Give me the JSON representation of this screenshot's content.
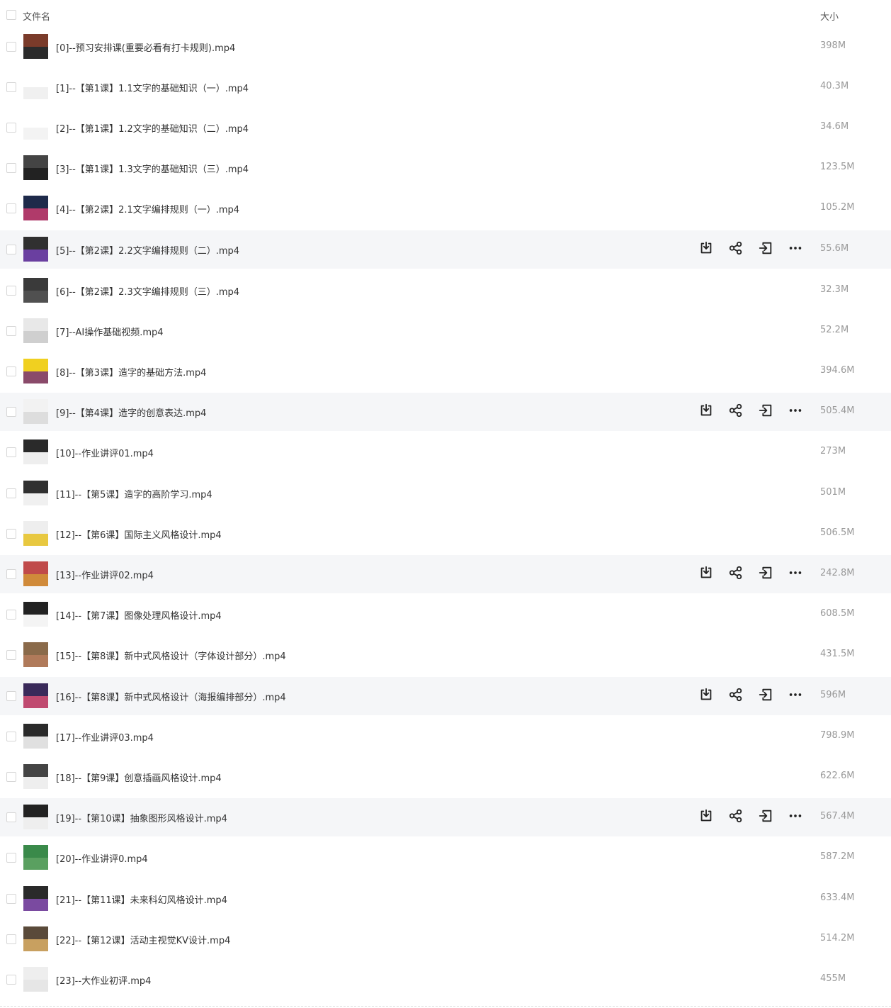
{
  "header": {
    "name_label": "文件名",
    "size_label": "大小"
  },
  "row_actions": [
    "download-icon",
    "share-icon",
    "move-icon",
    "more-icon"
  ],
  "colors": {
    "highlight": "#f5f6f8",
    "muted_text": "#999999",
    "text": "#333333"
  },
  "files": [
    {
      "name": "[0]--预习安排课(重要必看有打卡规则).mp4",
      "size": "398M",
      "thumb": [
        "#7a3b2a",
        "#2b2b2b"
      ]
    },
    {
      "name": "[1]--【第1课】1.1文字的基础知识（一）.mp4",
      "size": "40.3M",
      "thumb": [
        "#ffffff",
        "#f0f0f0"
      ]
    },
    {
      "name": "[2]--【第1课】1.2文字的基础知识（二）.mp4",
      "size": "34.6M",
      "thumb": [
        "#ffffff",
        "#f3f3f3"
      ]
    },
    {
      "name": "[3]--【第1课】1.3文字的基础知识（三）.mp4",
      "size": "123.5M",
      "thumb": [
        "#444444",
        "#222222"
      ]
    },
    {
      "name": "[4]--【第2课】2.1文字编排规则（一）.mp4",
      "size": "105.2M",
      "thumb": [
        "#1e2a4a",
        "#b03a6a"
      ]
    },
    {
      "name": "[5]--【第2课】2.2文字编排规则（二）.mp4",
      "size": "55.6M",
      "thumb": [
        "#303030",
        "#6a3fa0"
      ]
    },
    {
      "name": "[6]--【第2课】2.3文字编排规则（三）.mp4",
      "size": "32.3M",
      "thumb": [
        "#3a3a3a",
        "#505050"
      ]
    },
    {
      "name": "[7]--AI操作基础视频.mp4",
      "size": "52.2M",
      "thumb": [
        "#e8e8e8",
        "#cfcfcf"
      ]
    },
    {
      "name": "[8]--【第3课】造字的基础方法.mp4",
      "size": "394.6M",
      "thumb": [
        "#f0d020",
        "#8a4a6a"
      ]
    },
    {
      "name": "[9]--【第4课】造字的创意表达.mp4",
      "size": "505.4M",
      "thumb": [
        "#f2f2f2",
        "#dddddd"
      ]
    },
    {
      "name": "[10]--作业讲评01.mp4",
      "size": "273M",
      "thumb": [
        "#2a2a2a",
        "#eeeeee"
      ]
    },
    {
      "name": "[11]--【第5课】造字的高阶学习.mp4",
      "size": "501M",
      "thumb": [
        "#303030",
        "#f0f0f0"
      ]
    },
    {
      "name": "[12]--【第6课】国际主义风格设计.mp4",
      "size": "506.5M",
      "thumb": [
        "#eeeeee",
        "#e8c840"
      ]
    },
    {
      "name": "[13]--作业讲评02.mp4",
      "size": "242.8M",
      "thumb": [
        "#c04a4a",
        "#d08a3a"
      ]
    },
    {
      "name": "[14]--【第7课】图像处理风格设计.mp4",
      "size": "608.5M",
      "thumb": [
        "#222222",
        "#f4f4f4"
      ]
    },
    {
      "name": "[15]--【第8课】新中式风格设计（字体设计部分）.mp4",
      "size": "431.5M",
      "thumb": [
        "#8a6a4a",
        "#b07a5a"
      ]
    },
    {
      "name": "[16]--【第8课】新中式风格设计（海报编排部分）.mp4",
      "size": "596M",
      "thumb": [
        "#3a2a5a",
        "#c04a70"
      ]
    },
    {
      "name": "[17]--作业讲评03.mp4",
      "size": "798.9M",
      "thumb": [
        "#2a2a2a",
        "#e0e0e0"
      ]
    },
    {
      "name": "[18]--【第9课】创意插画风格设计.mp4",
      "size": "622.6M",
      "thumb": [
        "#444444",
        "#eeeeee"
      ]
    },
    {
      "name": "[19]--【第10课】抽象图形风格设计.mp4",
      "size": "567.4M",
      "thumb": [
        "#222222",
        "#eeeeee"
      ]
    },
    {
      "name": "[20]--作业讲评0.mp4",
      "size": "587.2M",
      "thumb": [
        "#3a8a4a",
        "#5aa060"
      ]
    },
    {
      "name": "[21]--【第11课】未来科幻风格设计.mp4",
      "size": "633.4M",
      "thumb": [
        "#2a2a2a",
        "#7a4aa0"
      ]
    },
    {
      "name": "[22]--【第12课】活动主视觉KV设计.mp4",
      "size": "514.2M",
      "thumb": [
        "#5a4a3a",
        "#c8a060"
      ]
    },
    {
      "name": "[23]--大作业初评.mp4",
      "size": "455M",
      "thumb": [
        "#eeeeee",
        "#e6e6e6"
      ]
    }
  ]
}
